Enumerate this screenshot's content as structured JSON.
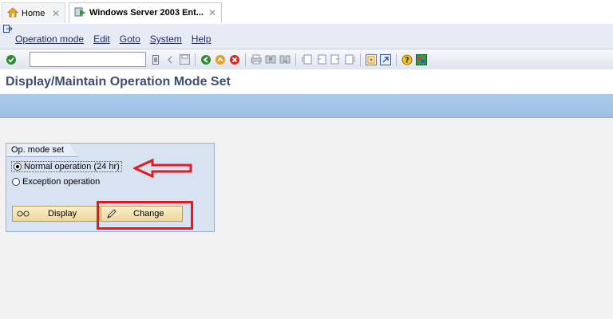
{
  "tabs": [
    {
      "label": "Home",
      "close": "✕"
    },
    {
      "label": "Windows Server 2003 Ent...",
      "close": "✕"
    }
  ],
  "menu": [
    "Operation mode",
    "Edit",
    "Goto",
    "System",
    "Help"
  ],
  "toolbar": {
    "command_value": ""
  },
  "page": {
    "title": "Display/Maintain Operation Mode Set"
  },
  "group": {
    "title": "Op. mode set",
    "options": [
      {
        "label": "Normal operation (24 hr)",
        "selected": true
      },
      {
        "label": "Exception operation",
        "selected": false
      }
    ]
  },
  "buttons": {
    "display": "Display",
    "change": "Change"
  },
  "annotation_color": "#e11b22"
}
